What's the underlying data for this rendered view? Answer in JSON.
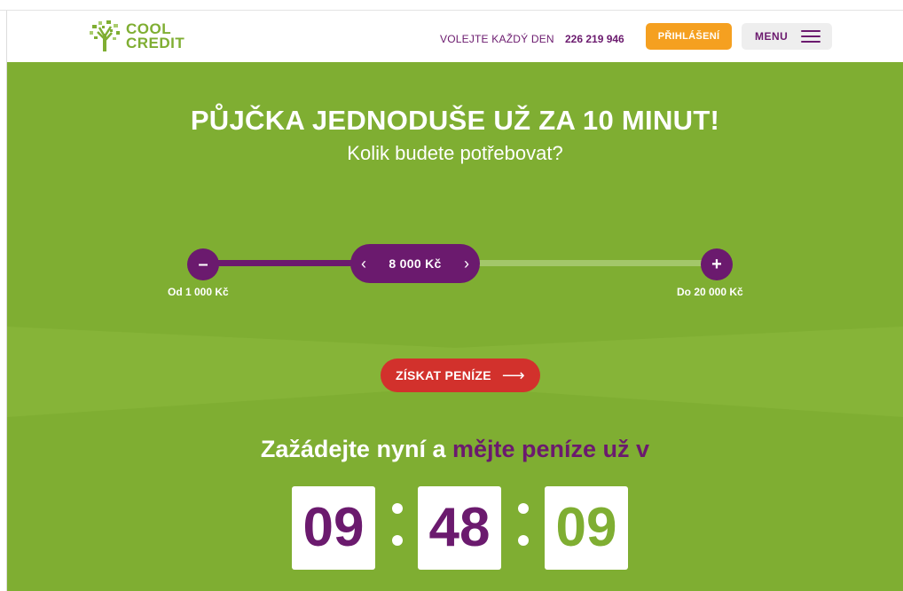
{
  "header": {
    "logo_line1": "COOL",
    "logo_line2": "CREDIT",
    "logo_icon": "tree-logo-icon",
    "call_label": "VOLEJTE KAŽDÝ DEN",
    "phone": "226 219 946",
    "login_label": "PŘIHLÁŠENÍ",
    "menu_label": "MENU",
    "menu_icon": "hamburger-icon"
  },
  "hero": {
    "headline": "PŮJČKA JEDNODUŠE UŽ ZA 10 MINUT!",
    "subline": "Kolik budete potřebovat?"
  },
  "slider": {
    "minus_label": "–",
    "plus_label": "+",
    "left_arrow": "‹",
    "right_arrow": "›",
    "value": "8 000 Kč",
    "min_label": "Od 1 000 Kč",
    "max_label": "Do 20 000 Kč",
    "fill_fraction": 0.37
  },
  "cta": {
    "label": "ZÍSKAT PENÍZE",
    "arrow": "⟶"
  },
  "countdown": {
    "title_part1": "Zažádejte nyní a",
    "title_part2": "mějte peníze už v",
    "hours": "09",
    "minutes": "48",
    "seconds": "09"
  },
  "colors": {
    "brand_green": "#7fae32",
    "brand_purple": "#6b1a6e",
    "login_orange": "#f5a020",
    "cta_red": "#d2312c"
  }
}
